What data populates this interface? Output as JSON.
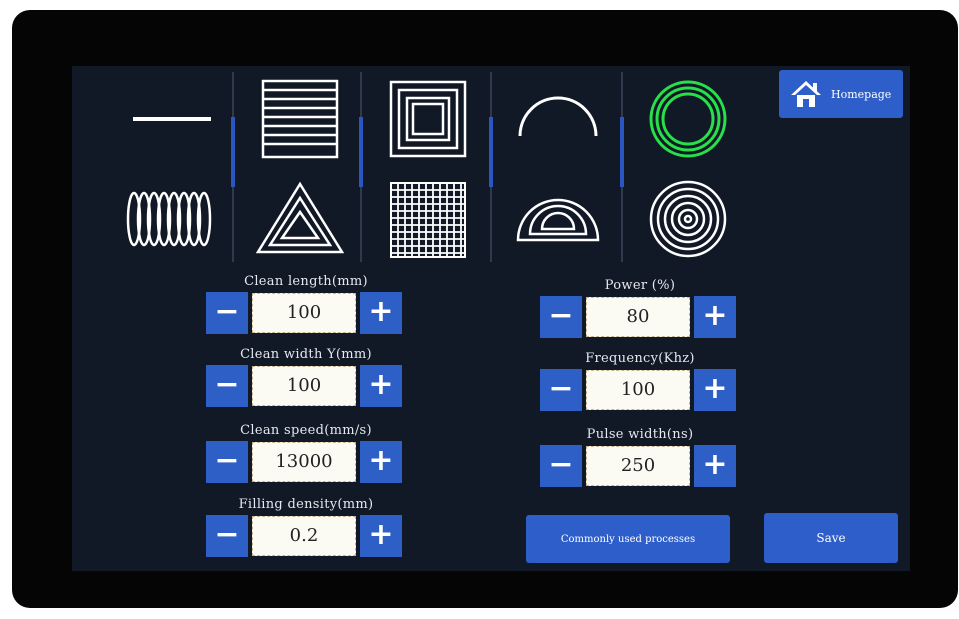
{
  "header": {
    "home_label": "Homepage",
    "home_icon": "home-icon"
  },
  "patterns": [
    {
      "name": "line",
      "icon": "line-pattern-icon"
    },
    {
      "name": "spiral-coil",
      "icon": "coil-pattern-icon"
    },
    {
      "name": "horizontal-lines-fill",
      "icon": "hatch-fill-icon"
    },
    {
      "name": "triangle-concentric",
      "icon": "triangle-pattern-icon"
    },
    {
      "name": "square-concentric",
      "icon": "square-pattern-icon"
    },
    {
      "name": "grid-fill",
      "icon": "grid-pattern-icon"
    },
    {
      "name": "arc",
      "icon": "arc-pattern-icon"
    },
    {
      "name": "semicircle-concentric",
      "icon": "semicircle-pattern-icon"
    },
    {
      "name": "ring-concentric-selected",
      "icon": "ring-pattern-icon"
    },
    {
      "name": "circle-concentric",
      "icon": "circle-pattern-icon"
    }
  ],
  "selected_color": "#27e04a",
  "accent_color": "#2e5ec9",
  "params_left": [
    {
      "label": "Clean length(mm)",
      "value": "100"
    },
    {
      "label": "Clean width Y(mm)",
      "value": "100"
    },
    {
      "label": "Clean speed(mm/s)",
      "value": "13000"
    },
    {
      "label": "Filling density(mm)",
      "value": "0.2"
    }
  ],
  "params_right": [
    {
      "label": "Power (%)",
      "value": "80"
    },
    {
      "label": "Frequency(Khz)",
      "value": "100"
    },
    {
      "label": "Pulse width(ns)",
      "value": "250"
    }
  ],
  "stepper": {
    "minus": "−",
    "plus": "+"
  },
  "actions": {
    "common_processes": "Commonly used processes",
    "save": "Save"
  }
}
